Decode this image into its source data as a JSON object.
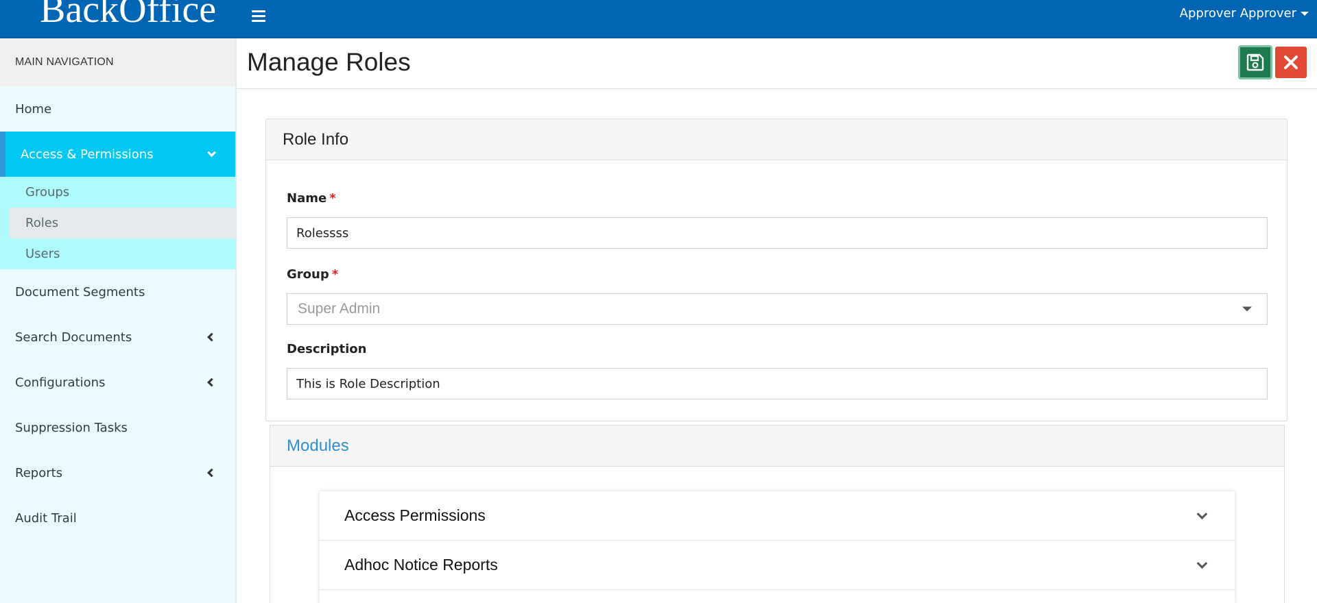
{
  "header": {
    "brand": "BackOffice",
    "user_name": "Approver Approver"
  },
  "sidebar": {
    "section_title": "MAIN NAVIGATION",
    "items": [
      {
        "label": "Home"
      },
      {
        "label": "Access & Permissions",
        "active": true
      },
      {
        "label": "Document Segments"
      },
      {
        "label": "Search Documents"
      },
      {
        "label": "Configurations"
      },
      {
        "label": "Suppression Tasks"
      },
      {
        "label": "Reports"
      },
      {
        "label": "Audit Trail"
      }
    ],
    "submenu": [
      {
        "label": "Groups"
      },
      {
        "label": "Roles",
        "selected": true
      },
      {
        "label": "Users"
      }
    ]
  },
  "page": {
    "title": "Manage Roles",
    "save_icon": "save-icon",
    "close_icon": "close-icon"
  },
  "role_info": {
    "title": "Role Info",
    "name_label": "Name",
    "name_value": "Rolessss",
    "group_label": "Group",
    "group_value": "Super Admin",
    "description_label": "Description",
    "description_value": "This is Role Description",
    "required_marker": "*"
  },
  "modules": {
    "title": "Modules",
    "items": [
      {
        "label": "Access Permissions"
      },
      {
        "label": "Adhoc Notice Reports"
      }
    ]
  },
  "colors": {
    "topbar": "#0066b3",
    "sidebar_active": "#00c8f2",
    "submenu_bg": "#aefafd",
    "save_button": "#1d7a4e",
    "close_button": "#e24a35",
    "modules_title": "#2f8fce"
  }
}
